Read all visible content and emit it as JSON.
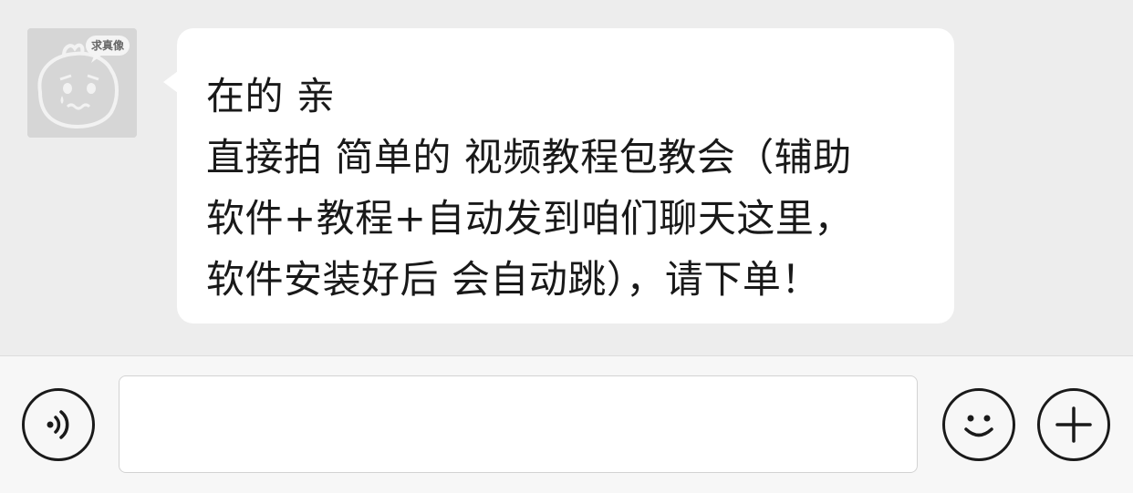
{
  "chat": {
    "contact": {
      "avatar_icon": "crying-cartoon-avatar",
      "avatar_tag": "求真像"
    },
    "messages": [
      {
        "from": "contact",
        "lines": [
          "在的 亲",
          "直接拍 简单的 视频教程包教会（辅助",
          "软件+教程+自动发到咱们聊天这里，",
          "软件安装好后 会自动跳），请下单！"
        ]
      }
    ]
  },
  "input_bar": {
    "voice_icon": "voice-icon",
    "text_value": "",
    "emoji_icon": "smiley-icon",
    "more_icon": "plus-icon"
  },
  "colors": {
    "chat_background": "#ededed",
    "bubble_background": "#ffffff",
    "text": "#191919",
    "input_bar_background": "#f7f7f7",
    "icon_stroke": "#1a1a1a"
  }
}
